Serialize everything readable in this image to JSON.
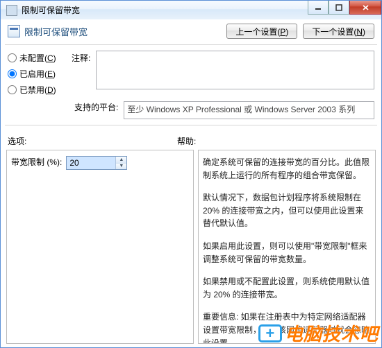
{
  "window": {
    "title": "限制可保留带宽"
  },
  "header": {
    "title": "限制可保留带宽"
  },
  "nav": {
    "prev": "上一个设置(",
    "prev_ak": "P",
    "prev_suffix": ")",
    "next": "下一个设置(",
    "next_ak": "N",
    "next_suffix": ")"
  },
  "radios": {
    "unconfigured": "未配置(",
    "unconfigured_ak": "C",
    "unconfigured_suffix": ")",
    "enabled": "已启用(",
    "enabled_ak": "E",
    "enabled_suffix": ")",
    "disabled": "已禁用(",
    "disabled_ak": "D",
    "disabled_suffix": ")",
    "selected": "enabled"
  },
  "labels": {
    "comment": "注释:",
    "platform": "支持的平台:",
    "options": "选项:",
    "help": "帮助:"
  },
  "comment_value": "",
  "platform_value": "至少 Windows XP Professional 或 Windows Server 2003 系列",
  "options": {
    "bandwidth_label": "带宽限制 (%):",
    "bandwidth_value": "20"
  },
  "help": {
    "p1": "确定系统可保留的连接带宽的百分比。此值限制系统上运行的所有程序的组合带宽保留。",
    "p2": "默认情况下，数据包计划程序将系统限制在 20% 的连接带宽之内，但可以使用此设置来替代默认值。",
    "p3": "如果启用此设置，则可以使用\"带宽限制\"框来调整系统可保留的带宽数量。",
    "p4": "如果禁用或不配置此设置，则系统使用默认值为 20% 的连接带宽。",
    "p5": "重要信息: 如果在注册表中为特定网络适配器设置带宽限制，配置该网络适配器时就会忽略此设置。"
  },
  "watermark": "电脑技术吧"
}
